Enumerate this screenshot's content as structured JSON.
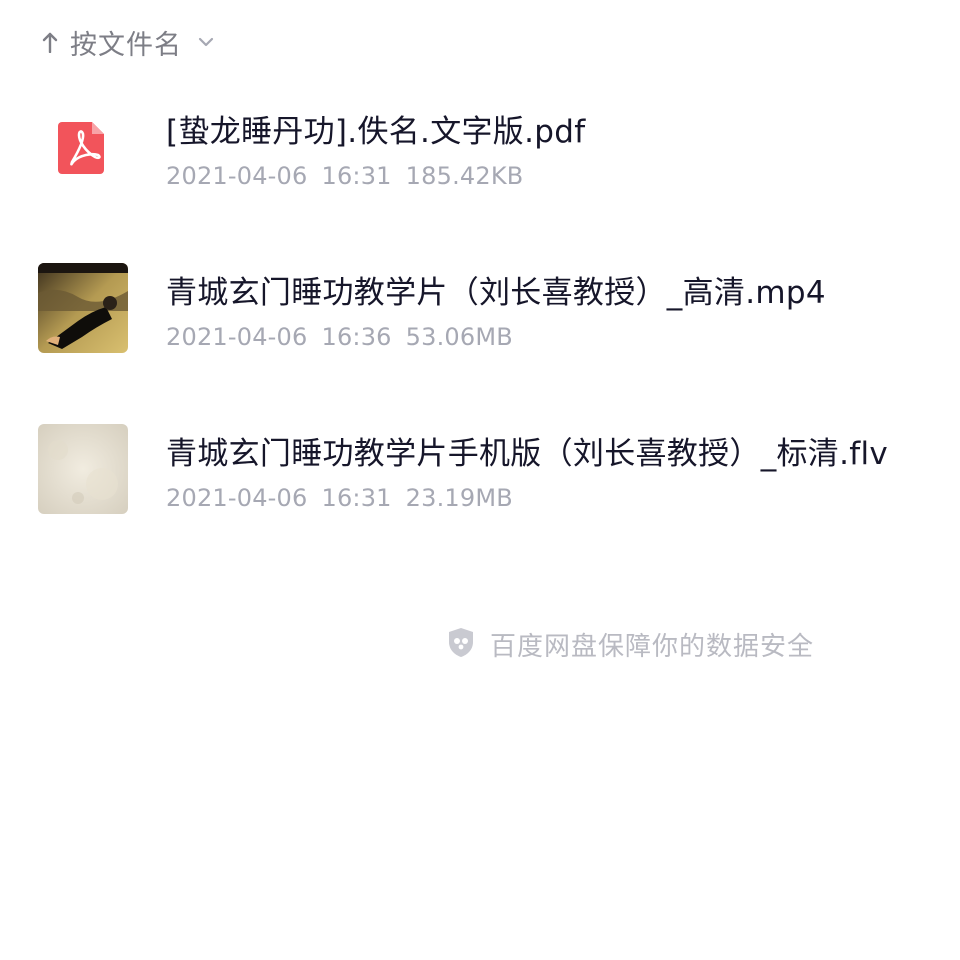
{
  "sort": {
    "label": "按文件名",
    "direction_icon": "arrow-up-icon",
    "dropdown_icon": "chevron-down-icon"
  },
  "files": [
    {
      "name": "[蛰龙睡丹功].佚名.文字版.pdf",
      "date": "2021-04-06",
      "time": "16:31",
      "size": "185.42KB",
      "icon": "pdf-file-icon"
    },
    {
      "name": "青城玄门睡功教学片（刘长喜教授）_高清.mp4",
      "date": "2021-04-06",
      "time": "16:36",
      "size": "53.06MB",
      "icon": "video-thumbnail"
    },
    {
      "name": "青城玄门睡功教学片手机版（刘长喜教授）_标清.flv",
      "date": "2021-04-06",
      "time": "16:31",
      "size": "23.19MB",
      "icon": "video-thumbnail"
    }
  ],
  "footer": {
    "text": "百度网盘保障你的数据安全",
    "icon": "shield-icon"
  },
  "colors": {
    "pdf_icon": "#f2545b",
    "meta_text": "#a6a8b3",
    "name_text": "#16162a",
    "sort_text": "#7d7e86",
    "footer_text": "#b9bac2"
  }
}
